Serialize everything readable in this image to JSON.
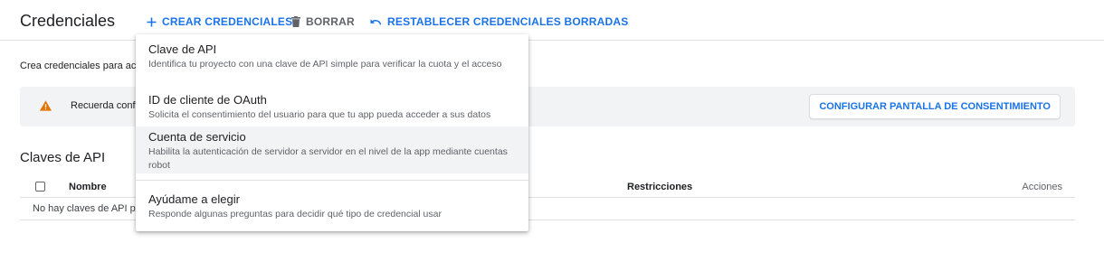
{
  "header": {
    "title": "Credenciales",
    "create_label": "CREAR CREDENCIALES",
    "delete_label": "BORRAR",
    "restore_label": "RESTABLECER CREDENCIALES BORRADAS"
  },
  "intro_text": "Crea credenciales para acc",
  "banner": {
    "text": "Recuerda conf",
    "consent_button": "CONFIGURAR PANTALLA DE CONSENTIMIENTO"
  },
  "api_keys": {
    "title": "Claves de API",
    "columns": {
      "name": "Nombre",
      "restrictions": "Restricciones",
      "actions": "Acciones"
    },
    "empty_text": "No hay claves de API pa"
  },
  "menu": {
    "items": [
      {
        "title": "Clave de API",
        "desc": "Identifica tu proyecto con una clave de API simple para verificar la cuota y el acceso"
      },
      {
        "title": "ID de cliente de OAuth",
        "desc": "Solicita el consentimiento del usuario para que tu app pueda acceder a sus datos"
      },
      {
        "title": "Cuenta de servicio",
        "desc": "Habilita la autenticación de servidor a servidor en el nivel de la app mediante cuentas robot"
      },
      {
        "title": "Ayúdame a elegir",
        "desc": "Responde algunas preguntas para decidir qué tipo de credencial usar"
      }
    ]
  },
  "colors": {
    "accent": "#1a73e8",
    "warning": "#e37400",
    "banner_bg": "#f1f3f4"
  },
  "icons": {
    "create": "plus-icon",
    "delete": "trash-icon",
    "restore": "undo-icon",
    "warning": "warning-icon"
  }
}
